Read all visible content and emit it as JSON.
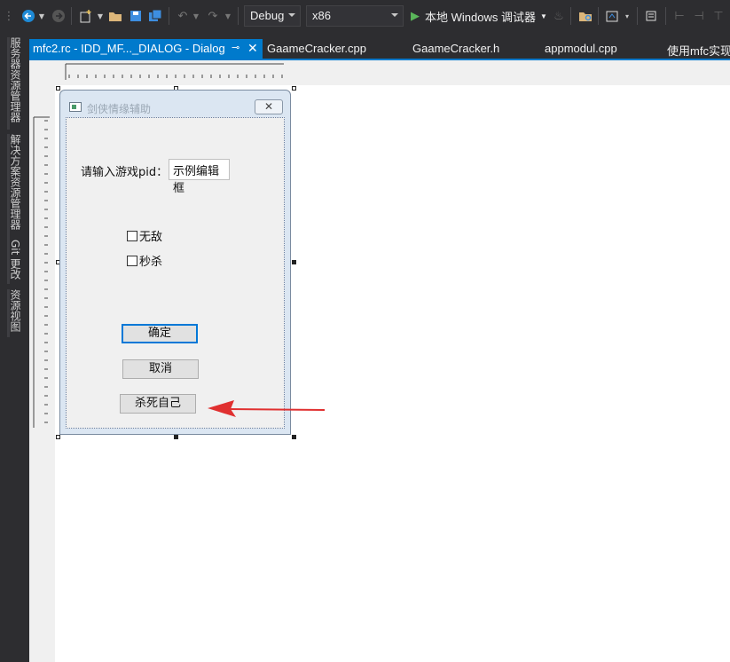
{
  "toolbar": {
    "config": "Debug",
    "platform": "x86",
    "debugger": "本地 Windows 调试器"
  },
  "left_tabs": [
    "服务器资源管理器",
    "解决方案资源管理器",
    "Git 更改",
    "资源视图"
  ],
  "tabs": [
    {
      "label": "mfc2.rc - IDD_MF..._DIALOG - Dialog"
    },
    {
      "label": "GaameCracker.cpp"
    },
    {
      "label": "GaameCracker.h"
    },
    {
      "label": "appmodul.cpp"
    },
    {
      "label": "使用mfc实现a"
    }
  ],
  "dialog": {
    "title": "剑侠情缘辅助",
    "pid_label": "请输入游戏pid：",
    "edit_text": "示例编辑框",
    "check1": "无敌",
    "check2": "秒杀",
    "ok": "确定",
    "cancel": "取消",
    "kill": "杀死自己"
  },
  "colors": {
    "accent": "#007acc",
    "arrow": "#e03030"
  }
}
